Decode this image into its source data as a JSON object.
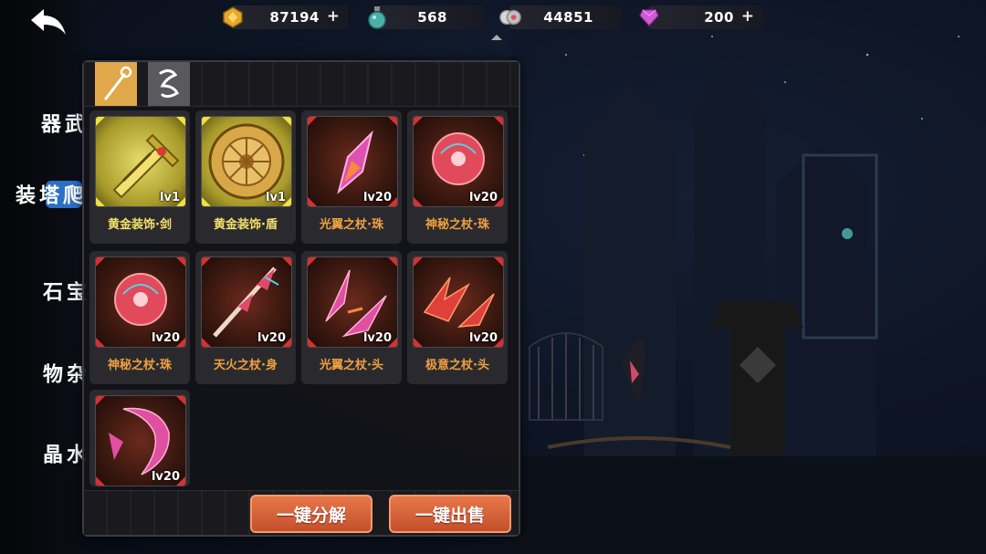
{
  "resources": [
    {
      "icon": "gold-coin-icon",
      "value": "87194",
      "has_plus": true
    },
    {
      "icon": "potion-icon",
      "value": "568",
      "has_plus": false
    },
    {
      "icon": "soul-gem-icon",
      "value": "44851",
      "has_plus": false
    },
    {
      "icon": "pink-diamond-icon",
      "value": "200",
      "has_plus": true
    }
  ],
  "plus_label": "+",
  "side_nav": [
    {
      "label": "武器",
      "active": false
    },
    {
      "label": "爬塔装",
      "active": true
    },
    {
      "label": "宝石",
      "active": false
    },
    {
      "label": "杂物",
      "active": false
    },
    {
      "label": "水晶",
      "active": false
    }
  ],
  "tabs": [
    {
      "icon": "staff-icon",
      "active": true
    },
    {
      "icon": "rune-icon",
      "active": false
    }
  ],
  "items": [
    {
      "name": "黄金装饰·剑",
      "level": "lv1",
      "rarity": "gold",
      "icon": "golden-sword-icon"
    },
    {
      "name": "黄金装饰·盾",
      "level": "lv1",
      "rarity": "gold",
      "icon": "golden-shield-icon"
    },
    {
      "name": "光翼之杖·珠",
      "level": "lv20",
      "rarity": "red",
      "icon": "crystal-shard-icon"
    },
    {
      "name": "神秘之杖·珠",
      "level": "lv20",
      "rarity": "red",
      "icon": "mystic-orb-icon"
    },
    {
      "name": "神秘之杖·珠",
      "level": "lv20",
      "rarity": "red",
      "icon": "mystic-orb-icon"
    },
    {
      "name": "天火之杖·身",
      "level": "lv20",
      "rarity": "red",
      "icon": "fire-staff-icon"
    },
    {
      "name": "光翼之杖·头",
      "level": "lv20",
      "rarity": "red",
      "icon": "wing-blade-icon"
    },
    {
      "name": "极意之杖·头",
      "level": "lv20",
      "rarity": "red",
      "icon": "claw-blade-icon"
    },
    {
      "name": "",
      "level": "lv20",
      "rarity": "red",
      "icon": "crescent-blade-icon"
    }
  ],
  "buttons": {
    "dismantle_all": "一键分解",
    "sell_all": "一键出售"
  }
}
